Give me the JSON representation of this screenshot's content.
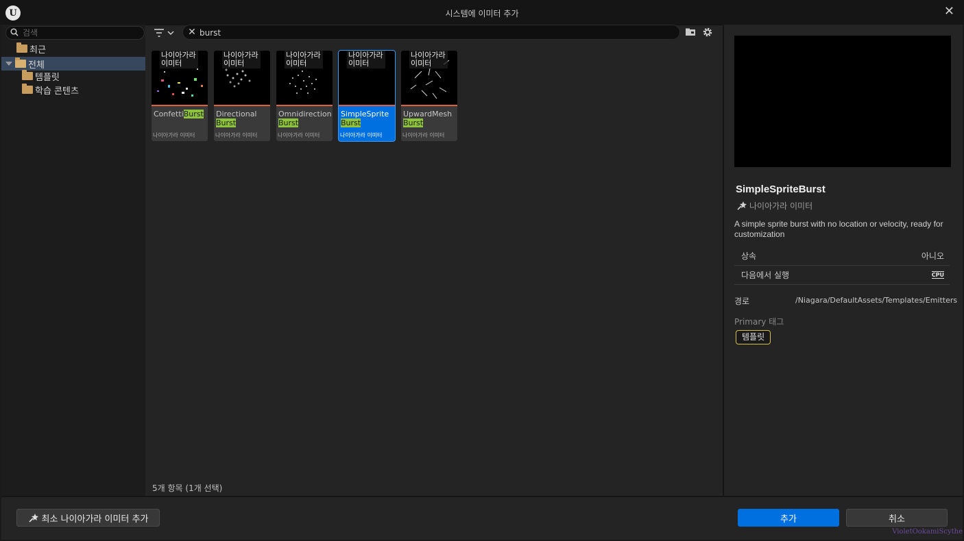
{
  "window": {
    "title": "시스템에 이미터 추가"
  },
  "left": {
    "search_placeholder": "검색",
    "tree": [
      {
        "label": "최근"
      },
      {
        "label": "전체"
      },
      {
        "label": "템플릿"
      },
      {
        "label": "학습 콘텐츠"
      }
    ]
  },
  "toolbar": {
    "search_value": "burst"
  },
  "tiles": [
    {
      "overlay": "나이아가라 이미터",
      "name_prefix": "Confetti",
      "name_hl": "Burst",
      "type": "나이아가라 이미터"
    },
    {
      "overlay": "나이아가라 이미터",
      "name_prefix": "Directional",
      "name_hl": "Burst",
      "type": "나이아가라 이미터"
    },
    {
      "overlay": "나이아가라 이미터",
      "name_prefix": "Omnidirectional",
      "name_hl": "Burst",
      "type": "나이아가라 이미터"
    },
    {
      "overlay": "나이아가라 이미터",
      "name_prefix": "SimpleSprite",
      "name_hl": "Burst",
      "type": "나이아가라 이미터"
    },
    {
      "overlay": "나이아가라 이미터",
      "name_prefix": "UpwardMesh",
      "name_hl": "Burst",
      "type": "나이아가라 이미터"
    }
  ],
  "status": "5개 항목 (1개 선택)",
  "details": {
    "title": "SimpleSpriteBurst",
    "type": "나이아가라 이미터",
    "description": "A simple sprite burst with no location or velocity, ready for customization",
    "inherit_label": "상속",
    "inherit_value": "아니오",
    "run_label": "다음에서 실행",
    "run_value": "CPU",
    "path_label": "경로",
    "path_value": "/Niagara/DefaultAssets/Templates/Emitters",
    "primary_tag_label": "Primary 태그",
    "tag": "템플릿"
  },
  "footer": {
    "min_button": "최소 나이아가라 이미터 추가",
    "add_button": "추가",
    "cancel_button": "취소"
  },
  "watermark": "VioletOokamiScythe"
}
